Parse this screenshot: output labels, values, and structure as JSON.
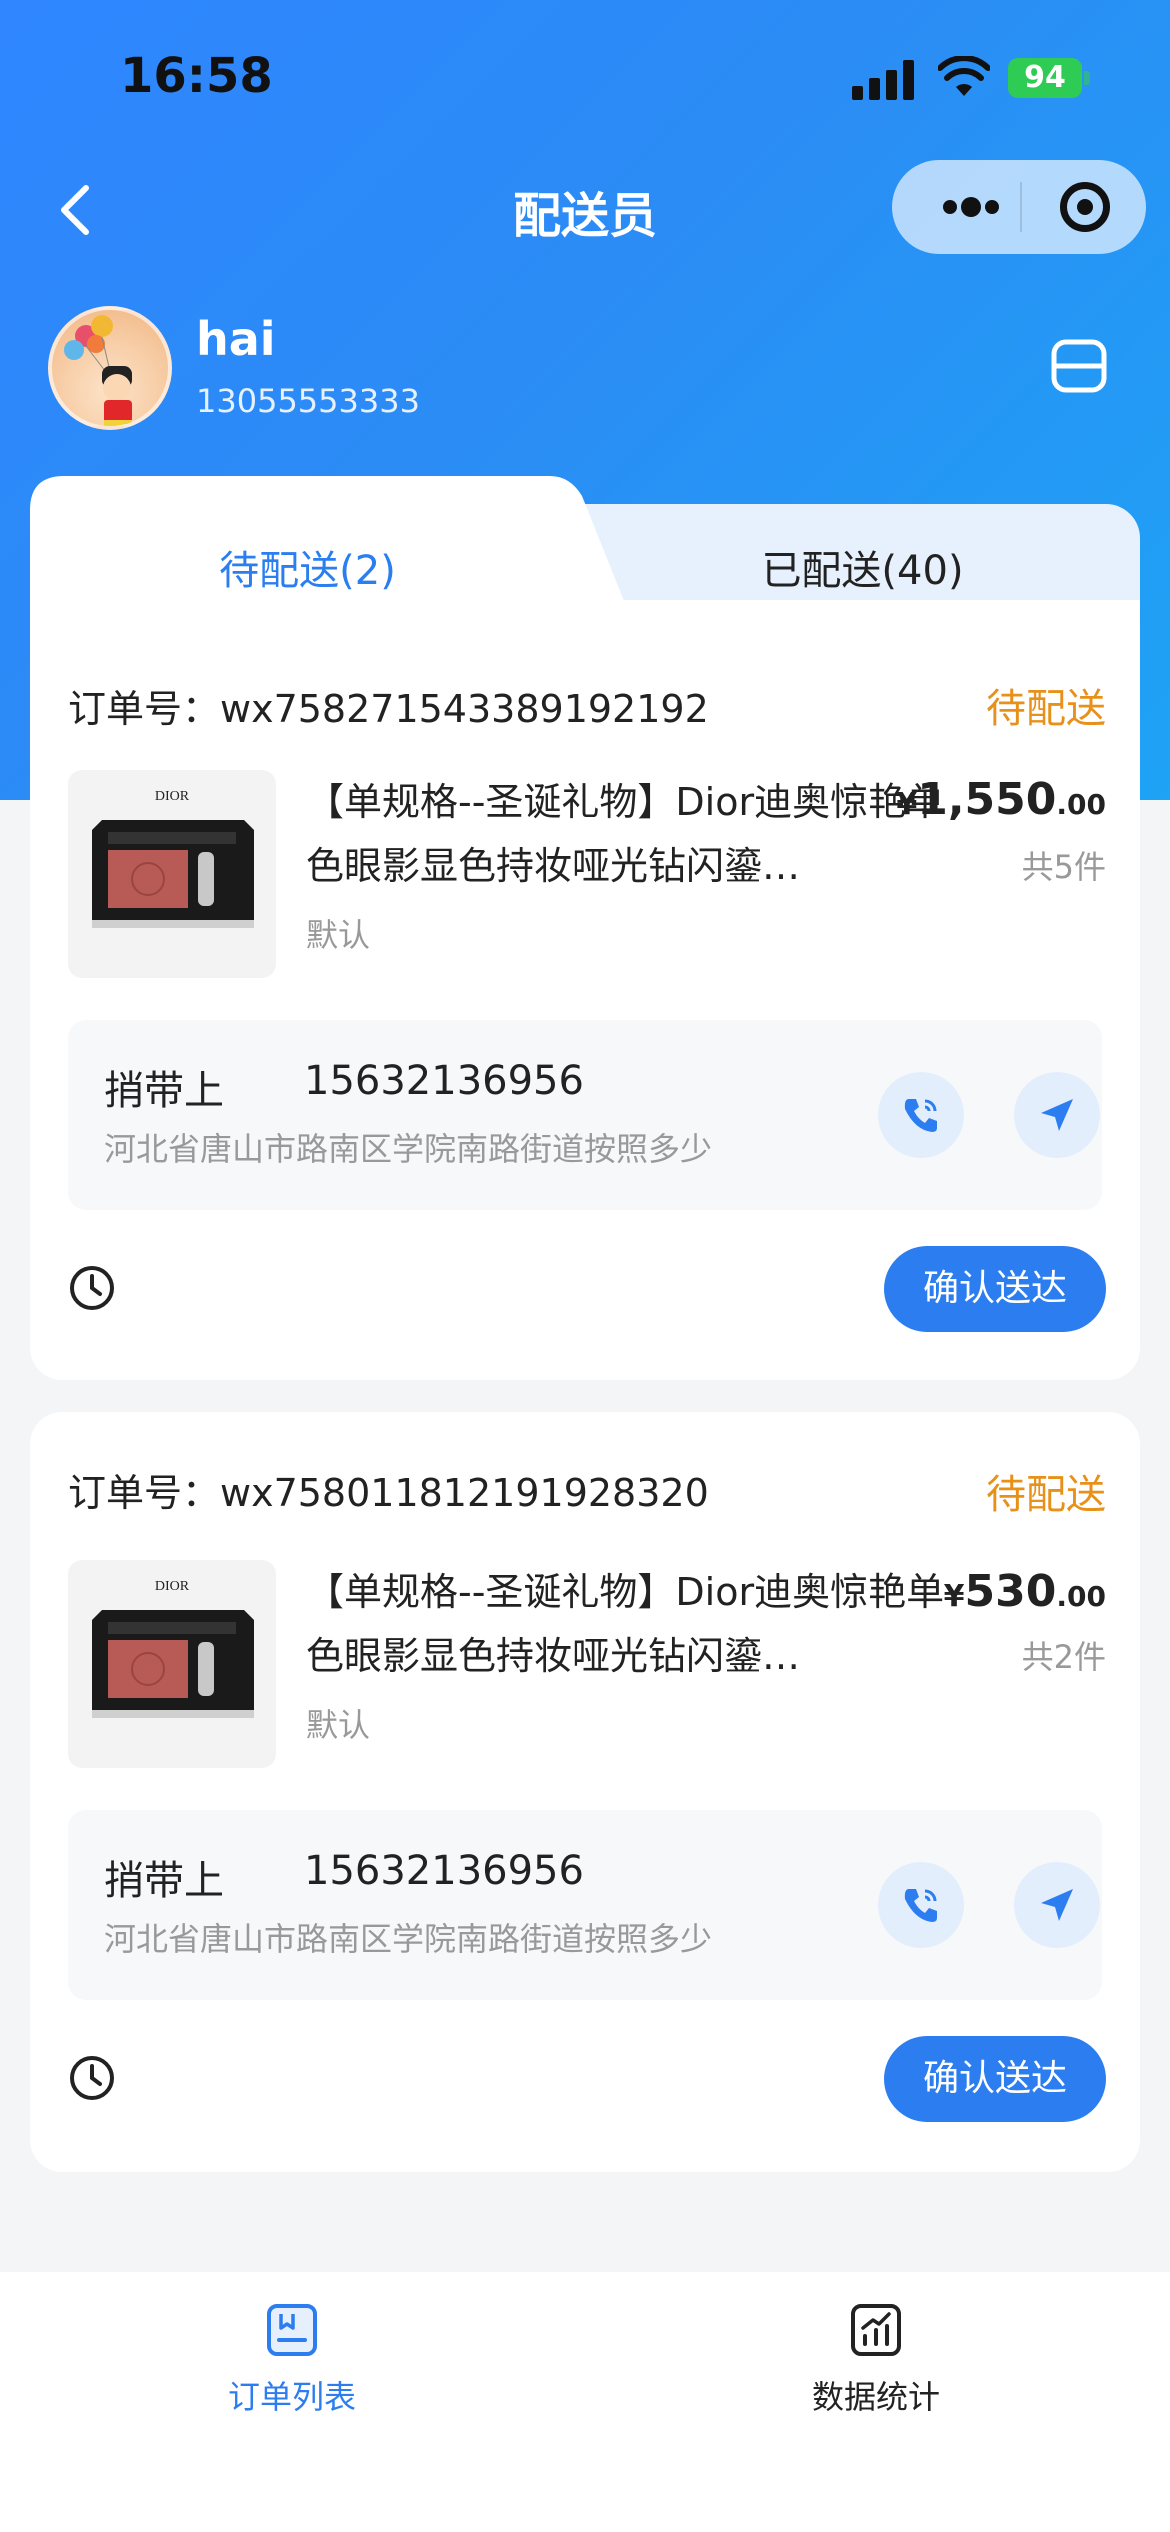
{
  "status_bar": {
    "time": "16:58",
    "battery": "94"
  },
  "nav": {
    "title": "配送员"
  },
  "user": {
    "name": "hai",
    "phone": "13055553333"
  },
  "tabs": [
    {
      "label": "待配送(2)",
      "active": true
    },
    {
      "label": "已配送(40)",
      "active": false
    }
  ],
  "orders": [
    {
      "order_label": "订单号：wx758271543389192192",
      "status": "待配送",
      "product_title": "【单规格--圣诞礼物】Dior迪奥惊艳单色眼影显色持妆哑光钻闪鎏…",
      "spec": "默认",
      "currency": "¥",
      "price_int": "1,550",
      "price_dec": ".00",
      "count": "共5件",
      "receiver_name": "捎带上",
      "receiver_phone": "15632136956",
      "address": "河北省唐山市路南区学院南路街道按照多少",
      "confirm_label": "确认送达"
    },
    {
      "order_label": "订单号：wx758011812191928320",
      "status": "待配送",
      "product_title": "【单规格--圣诞礼物】Dior迪奥惊艳单色眼影显色持妆哑光钻闪鎏…",
      "spec": "默认",
      "currency": "¥",
      "price_int": "530",
      "price_dec": ".00",
      "count": "共2件",
      "receiver_name": "捎带上",
      "receiver_phone": "15632136956",
      "address": "河北省唐山市路南区学院南路街道按照多少",
      "confirm_label": "确认送达"
    }
  ],
  "tabbar": [
    {
      "label": "订单列表",
      "icon": "order-list-icon",
      "active": true
    },
    {
      "label": "数据统计",
      "icon": "stats-icon",
      "active": false
    }
  ],
  "colors": {
    "primary": "#2c7ef0",
    "status_orange": "#e8911a",
    "battery_green": "#2ecc55"
  },
  "thumb_brand": "DIOR"
}
